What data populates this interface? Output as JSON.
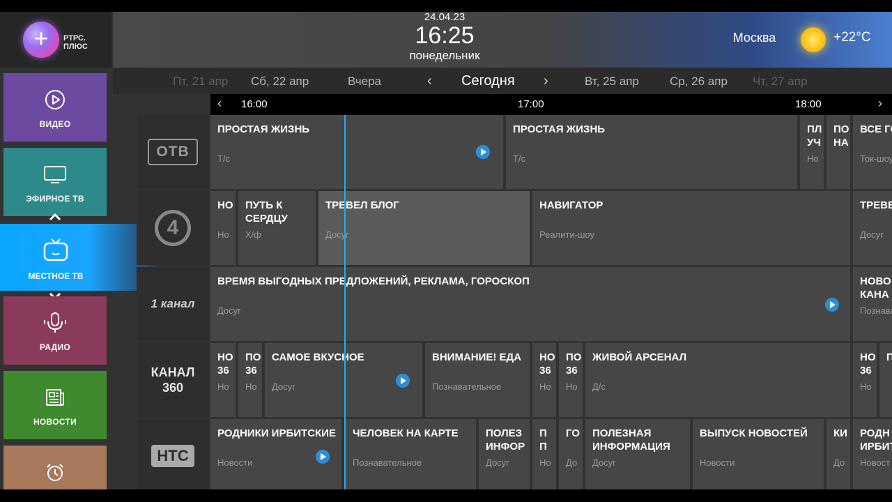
{
  "header": {
    "logo_text_line1": "РТРС.",
    "logo_text_line2": "ПЛЮС",
    "logo_symbol": "+",
    "date": "24.04.23",
    "time": "16:25",
    "weekday": "понедельник",
    "city": "Москва",
    "temperature": "+22°C",
    "weather_icon": "sun-icon"
  },
  "date_nav": {
    "days": [
      "Пт, 21 апр",
      "Сб, 22 апр",
      "Вчера",
      "Сегодня",
      "Вт, 25 апр",
      "Ср, 26 апр",
      "Чт, 27 апр"
    ],
    "prev_arrow": "‹",
    "next_arrow": "›"
  },
  "sidebar": {
    "items": [
      {
        "label": "ВИДЕО",
        "icon": "play-circle-icon",
        "color": "#6c4aa0"
      },
      {
        "label": "ЭФИРНОЕ ТВ",
        "icon": "tv-icon",
        "color": "#2e8a8a"
      },
      {
        "label": "МЕСТНОЕ ТВ",
        "icon": "retro-tv-icon",
        "color": "#0aa6ff"
      },
      {
        "label": "РАДИО",
        "icon": "microphone-icon",
        "color": "#8a3a5a"
      },
      {
        "label": "НОВОСТИ",
        "icon": "newspaper-icon",
        "color": "#3f8a2e"
      },
      {
        "label": "",
        "icon": "alarm-clock-icon",
        "color": "#a8785a"
      }
    ]
  },
  "timeline": {
    "labels": [
      "16:00",
      "17:00",
      "18:00"
    ],
    "prev": "‹",
    "next": "›"
  },
  "channels": [
    {
      "name": "ОТВ",
      "programs": [
        {
          "title": "ПРОСТАЯ ЖИЗНЬ",
          "genre": "Т/с"
        },
        {
          "title": "ПРОСТАЯ ЖИЗНЬ",
          "genre": "Т/с"
        },
        {
          "title": "ПЛ УЧ",
          "genre": "Но"
        },
        {
          "title": "ПО НА",
          "genre": ""
        },
        {
          "title": "ВСЕ ГО",
          "genre": "Ток-шоу"
        }
      ]
    },
    {
      "name": "4",
      "programs": [
        {
          "title": "НО",
          "genre": "Но"
        },
        {
          "title": "ПУТЬ К СЕРДЦУ",
          "genre": "Х/ф"
        },
        {
          "title": "ТРЕВЕЛ БЛОГ",
          "genre": "Досуг"
        },
        {
          "title": "НАВИГАТОР",
          "genre": "Реалити-шоу"
        },
        {
          "title": "ТРЕВЕ",
          "genre": "Досуг"
        }
      ]
    },
    {
      "name": "1 канал",
      "programs": [
        {
          "title": "ВРЕМЯ ВЫГОДНЫХ ПРЕДЛОЖЕНИЙ, РЕКЛАМА, ГОРОСКОП",
          "genre": "Досуг"
        },
        {
          "title": "НОВО КАНА",
          "genre": "Познава"
        }
      ]
    },
    {
      "name": "КАНАЛ 360",
      "programs": [
        {
          "title": "НО 36",
          "genre": "Но"
        },
        {
          "title": "ПО 36",
          "genre": "Но"
        },
        {
          "title": "САМОЕ ВКУСНОЕ",
          "genre": "Досуг"
        },
        {
          "title": "ВНИМАНИЕ! ЕДА",
          "genre": "Познавательное"
        },
        {
          "title": "НО 36",
          "genre": "Но"
        },
        {
          "title": "ПО 36",
          "genre": "Но"
        },
        {
          "title": "ЖИВОЙ АРСЕНАЛ",
          "genre": "Д/с"
        },
        {
          "title": "НО 36",
          "genre": "Но"
        },
        {
          "title": "П",
          "genre": ""
        }
      ]
    },
    {
      "name": "НТС",
      "programs": [
        {
          "title": "РОДНИКИ ИРБИТСКИЕ",
          "genre": "Новости"
        },
        {
          "title": "ЧЕЛОВЕК НА КАРТЕ",
          "genre": "Познавательное"
        },
        {
          "title": "ПОЛЕЗ ИНФОР",
          "genre": "Досуг"
        },
        {
          "title": "П П",
          "genre": "Но"
        },
        {
          "title": "ГО",
          "genre": "До"
        },
        {
          "title": "ПОЛЕЗНАЯ ИНФОРМАЦИЯ",
          "genre": "Досуг"
        },
        {
          "title": "ВЫПУСК НОВОСТЕЙ",
          "genre": "Новости"
        },
        {
          "title": "КИ",
          "genre": "До"
        },
        {
          "title": "РОДН ИРБИТ",
          "genre": "Новост"
        }
      ]
    }
  ],
  "colors": {
    "accent": "#0aa6ff",
    "now_line": "#2aa3ff",
    "play_button": "#2d8ed8",
    "cell_bg": "#464646"
  }
}
